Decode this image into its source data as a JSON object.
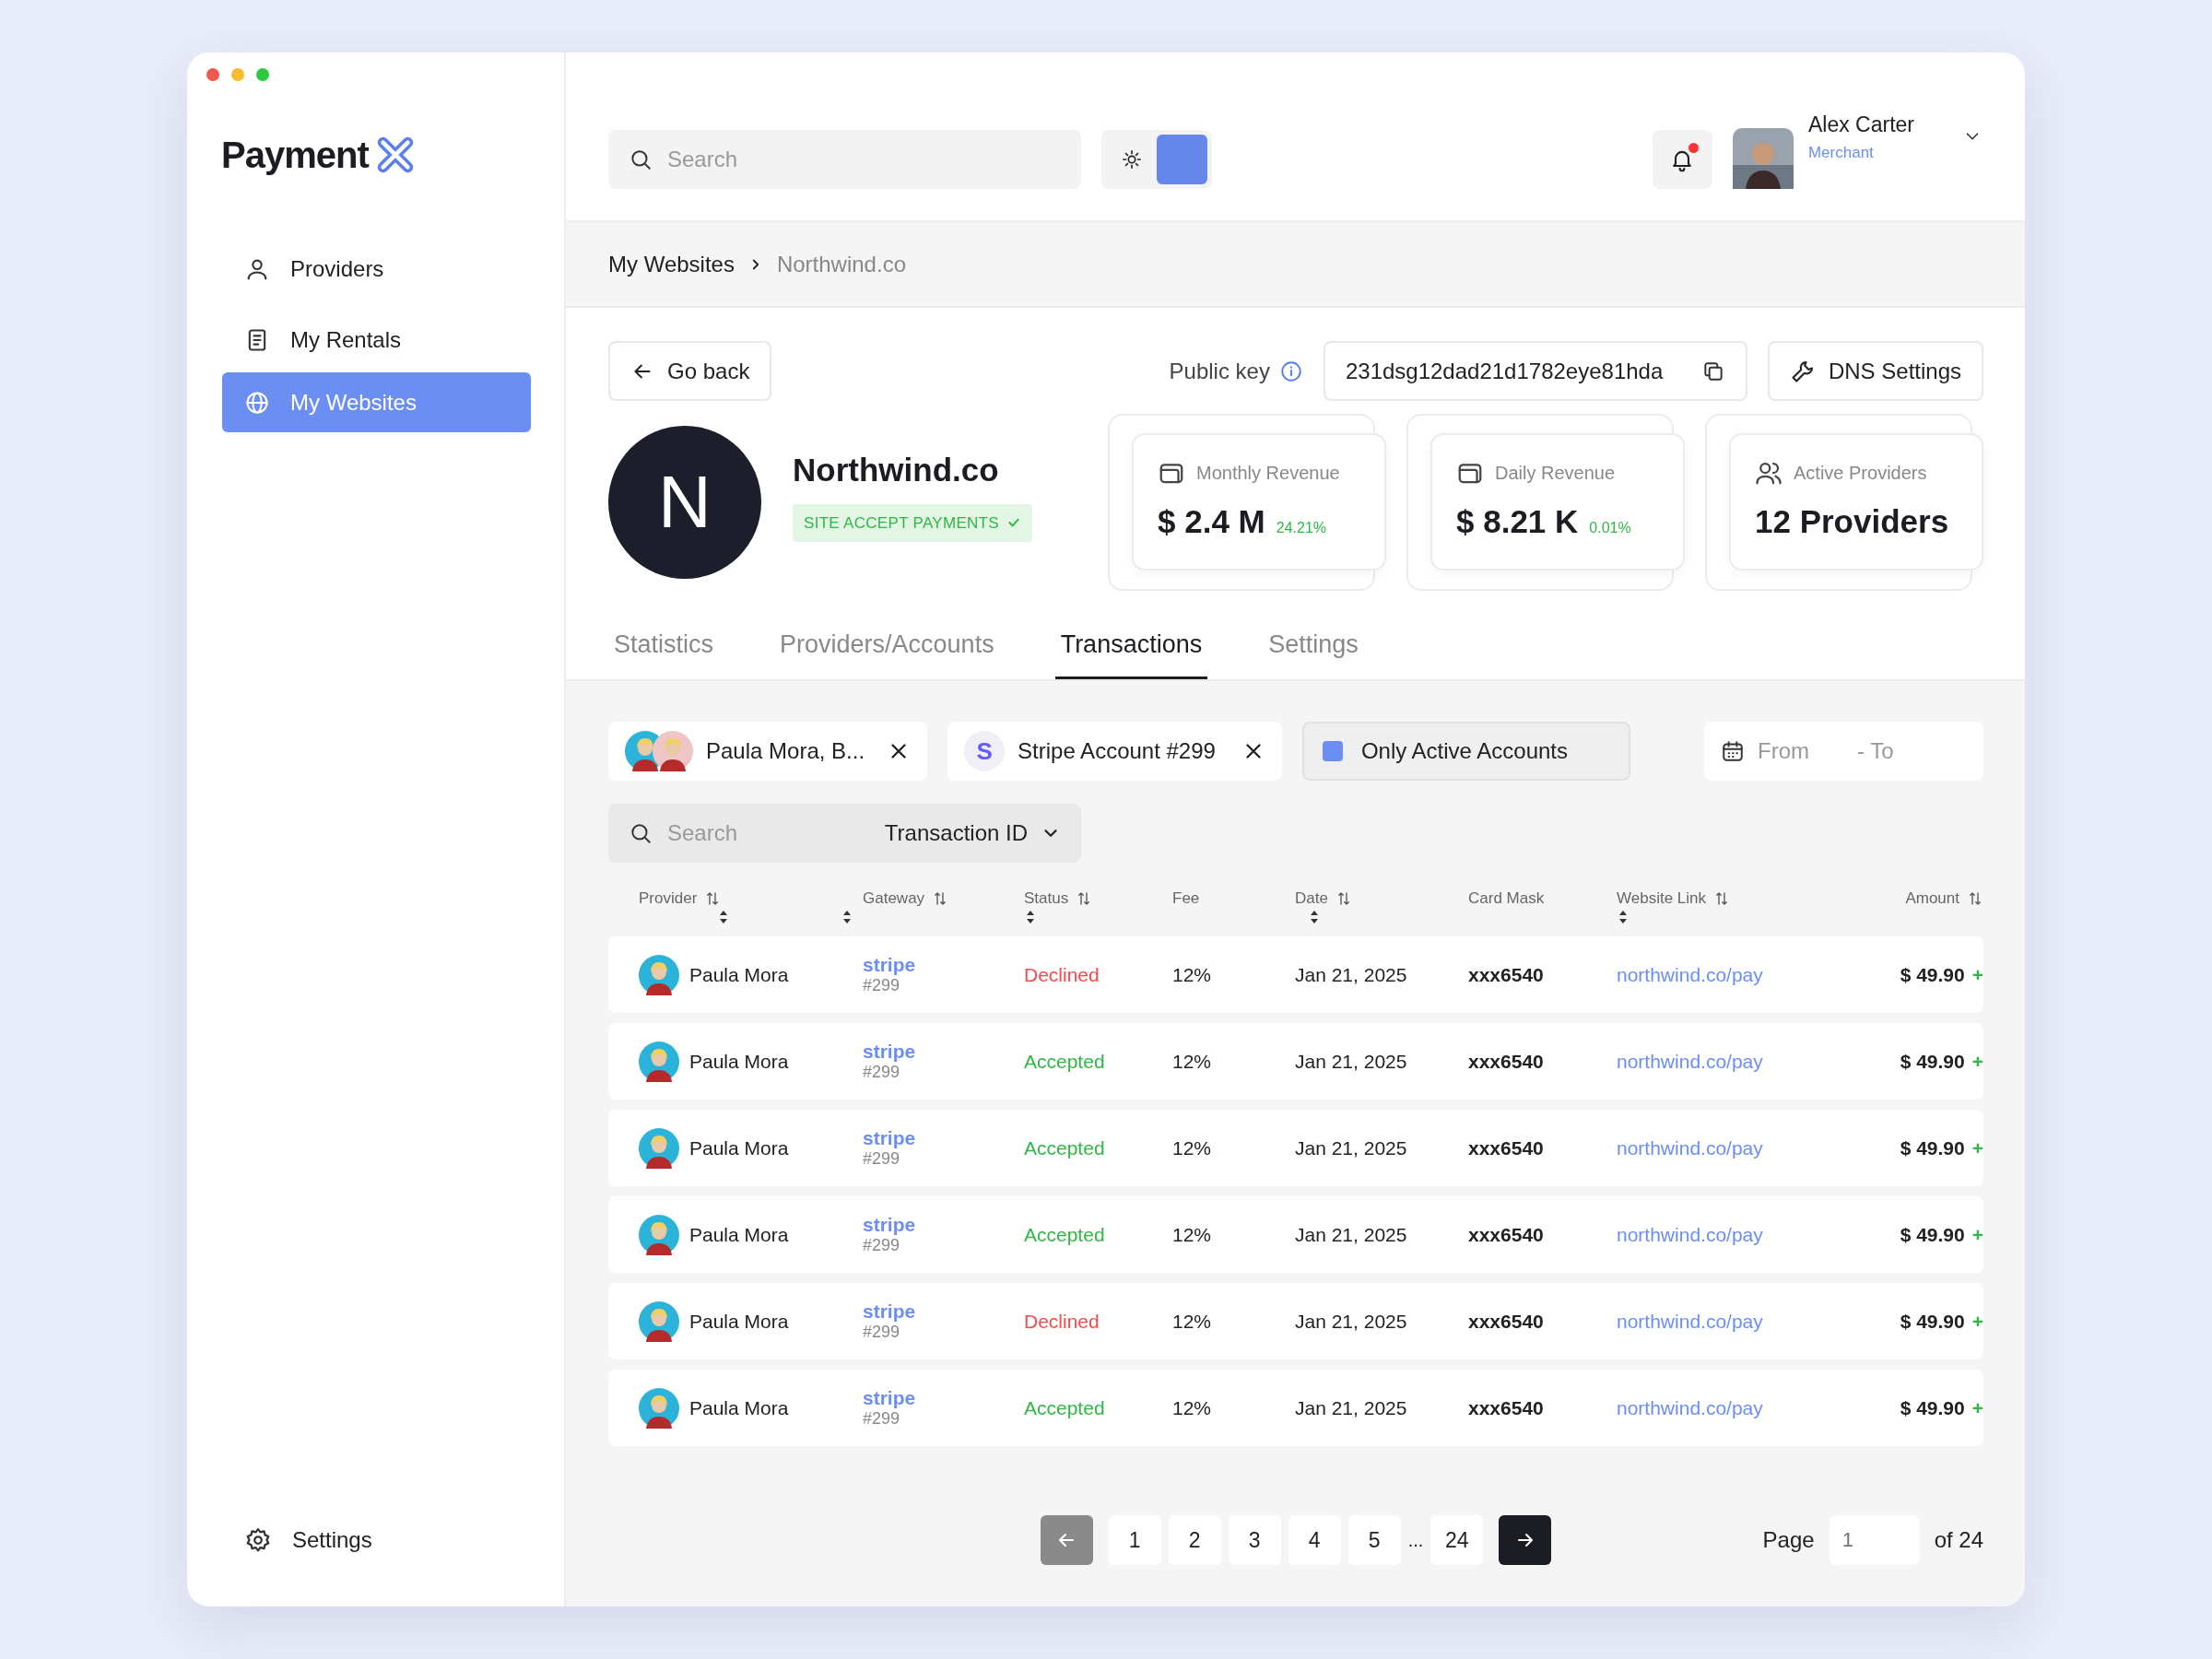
{
  "logo": {
    "text": "Payment"
  },
  "sidebar": {
    "items": [
      {
        "label": "Providers",
        "kind": "person",
        "selected": false
      },
      {
        "label": "My Rentals",
        "kind": "document",
        "selected": false
      },
      {
        "label": "My Websites",
        "kind": "globe",
        "selected": true
      }
    ],
    "footer": {
      "label": "Settings"
    }
  },
  "topbar": {
    "search": {
      "placeholder": "Search"
    },
    "theme_toggle": {
      "on": true
    },
    "notifications": {
      "unread": true
    },
    "user": {
      "name": "Alex Carter",
      "role": "Merchant"
    }
  },
  "breadcrumb": [
    "My Websites",
    "Northwind.co"
  ],
  "header": {
    "back": "Go back",
    "public_key_label": "Public key",
    "public_key": "231dsg12dad21d1782eye81hda",
    "dns_button": "DNS Settings"
  },
  "site": {
    "initial": "N",
    "name": "Northwind.co",
    "badge": "SITE ACCEPT PAYMENTS"
  },
  "stats": [
    {
      "kind": "wallet",
      "label": "Monthly Revenue",
      "value": "$ 2.4 M",
      "change": "24.21%"
    },
    {
      "kind": "wallet",
      "label": "Daily Revenue",
      "value": "$ 8.21 K",
      "change": "0.01%"
    },
    {
      "kind": "users",
      "label": "Active Providers",
      "value": "12 Providers"
    }
  ],
  "tabs": [
    {
      "label": "Statistics",
      "selected": false
    },
    {
      "label": "Providers/Accounts",
      "selected": false
    },
    {
      "label": "Transactions",
      "selected": true
    },
    {
      "label": "Settings",
      "selected": false
    }
  ],
  "filters": {
    "providers_chip": {
      "label": "Paula Mora, B..."
    },
    "gateway_chip": {
      "initial": "S",
      "label": "Stripe Account #299"
    },
    "active_only": {
      "label": "Only Active Accounts",
      "checked": true
    },
    "date": {
      "from": "From",
      "to": "- To"
    }
  },
  "table_search": {
    "placeholder": "Search",
    "field": "Transaction ID"
  },
  "table": {
    "columns": [
      {
        "label": "Provider",
        "sortable": true
      },
      {
        "label": "Gateway",
        "sortable": true
      },
      {
        "label": "Status",
        "sortable": true
      },
      {
        "label": "Fee",
        "sortable": false
      },
      {
        "label": "Date",
        "sortable": true
      },
      {
        "label": "Card Mask",
        "sortable": false
      },
      {
        "label": "Website Link",
        "sortable": true
      },
      {
        "label": "Amount",
        "sortable": true
      }
    ],
    "rows": [
      {
        "provider": "Paula Mora",
        "gateway": "stripe",
        "account": "#299",
        "status": "Declined",
        "color": "#f24c4c",
        "fee": "12%",
        "date": "Jan 21, 2025",
        "card": "xxx6540",
        "link": "northwind.co/pay",
        "amount": "$ 49.90",
        "sign": "+"
      },
      {
        "provider": "Paula Mora",
        "gateway": "stripe",
        "account": "#299",
        "status": "Accepted",
        "color": "#2fb845",
        "fee": "12%",
        "date": "Jan 21, 2025",
        "card": "xxx6540",
        "link": "northwind.co/pay",
        "amount": "$ 49.90",
        "sign": "+"
      },
      {
        "provider": "Paula Mora",
        "gateway": "stripe",
        "account": "#299",
        "status": "Accepted",
        "color": "#2fb845",
        "fee": "12%",
        "date": "Jan 21, 2025",
        "card": "xxx6540",
        "link": "northwind.co/pay",
        "amount": "$ 49.90",
        "sign": "+"
      },
      {
        "provider": "Paula Mora",
        "gateway": "stripe",
        "account": "#299",
        "status": "Accepted",
        "color": "#2fb845",
        "fee": "12%",
        "date": "Jan 21, 2025",
        "card": "xxx6540",
        "link": "northwind.co/pay",
        "amount": "$ 49.90",
        "sign": "+"
      },
      {
        "provider": "Paula Mora",
        "gateway": "stripe",
        "account": "#299",
        "status": "Declined",
        "color": "#f24c4c",
        "fee": "12%",
        "date": "Jan 21, 2025",
        "card": "xxx6540",
        "link": "northwind.co/pay",
        "amount": "$ 49.90",
        "sign": "+"
      },
      {
        "provider": "Paula Mora",
        "gateway": "stripe",
        "account": "#299",
        "status": "Accepted",
        "color": "#2fb845",
        "fee": "12%",
        "date": "Jan 21, 2025",
        "card": "xxx6540",
        "link": "northwind.co/pay",
        "amount": "$ 49.90",
        "sign": "+"
      }
    ]
  },
  "pagination": {
    "prev_disabled": true,
    "pages": [
      "1",
      "2",
      "3",
      "4",
      "5"
    ],
    "ellipsis": "...",
    "last": "24",
    "page_label": "Page",
    "page_placeholder": "1",
    "total": "of 24"
  }
}
